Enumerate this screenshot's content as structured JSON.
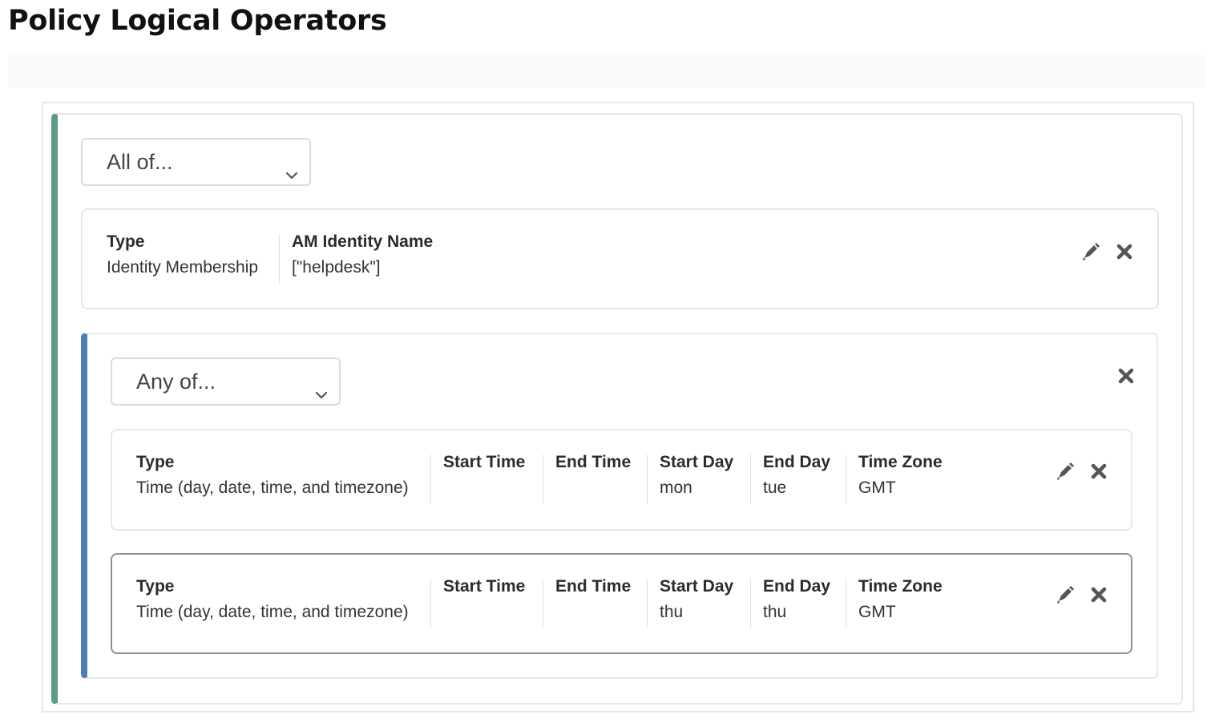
{
  "page": {
    "title": "Policy Logical Operators"
  },
  "colors": {
    "outer_group_accent": "#5d9a88",
    "inner_group_accent": "#4a7fb8",
    "icon": "#555555"
  },
  "outer_group": {
    "operator": {
      "selected": "All of...",
      "icon": "chevron-down-icon"
    },
    "conditions": [
      {
        "type_label": "Type",
        "type_value": "Identity Membership",
        "fields": [
          {
            "label": "AM Identity Name",
            "value": "[\"helpdesk\"]"
          }
        ],
        "actions": {
          "edit_icon": "pencil-icon",
          "remove_icon": "close-icon"
        }
      }
    ],
    "nested_group": {
      "operator": {
        "selected": "Any of...",
        "icon": "chevron-down-icon"
      },
      "remove_icon": "close-icon",
      "conditions": [
        {
          "type_label": "Type",
          "type_value": "Time (day, date, time, and timezone)",
          "fields": [
            {
              "label": "Start Time",
              "value": ""
            },
            {
              "label": "End Time",
              "value": ""
            },
            {
              "label": "Start Day",
              "value": "mon"
            },
            {
              "label": "End Day",
              "value": "tue"
            },
            {
              "label": "Time Zone",
              "value": "GMT"
            }
          ],
          "actions": {
            "edit_icon": "pencil-icon",
            "remove_icon": "close-icon"
          }
        },
        {
          "type_label": "Type",
          "type_value": "Time (day, date, time, and timezone)",
          "fields": [
            {
              "label": "Start Time",
              "value": ""
            },
            {
              "label": "End Time",
              "value": ""
            },
            {
              "label": "Start Day",
              "value": "thu"
            },
            {
              "label": "End Day",
              "value": "thu"
            },
            {
              "label": "Time Zone",
              "value": "GMT"
            }
          ],
          "actions": {
            "edit_icon": "pencil-icon",
            "remove_icon": "close-icon"
          }
        }
      ]
    }
  }
}
